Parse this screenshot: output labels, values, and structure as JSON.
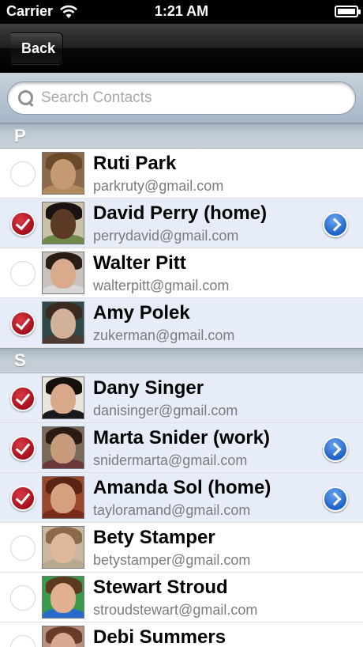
{
  "status_bar": {
    "carrier": "Carrier",
    "time": "1:21 AM"
  },
  "nav": {
    "back_label": "Back"
  },
  "search": {
    "placeholder": "Search Contacts",
    "value": ""
  },
  "sections": [
    {
      "letter": "P",
      "contacts": [
        {
          "name": "Ruti Park",
          "email": "parkruty@gmail.com",
          "selected": false,
          "has_detail": false,
          "skin": "#c59a72",
          "hair": "#6b4a2b",
          "shirt": "#b38a5e",
          "bg": "#8a6a4a"
        },
        {
          "name": "David Perry (home)",
          "email": "perrydavid@gmail.com",
          "selected": true,
          "has_detail": true,
          "skin": "#5a3a24",
          "hair": "#1a1210",
          "shirt": "#6f8a4a",
          "bg": "#c9c1a8"
        },
        {
          "name": "Walter Pitt",
          "email": "walterpitt@gmail.com",
          "selected": false,
          "has_detail": false,
          "skin": "#d9ab8c",
          "hair": "#2a1d14",
          "shirt": "#d8d8d8",
          "bg": "#c8c3be"
        },
        {
          "name": "Amy Polek",
          "email": "zukerman@gmail.com",
          "selected": true,
          "has_detail": false,
          "skin": "#d2b19a",
          "hair": "#3a2a20",
          "shirt": "#4a3a30",
          "bg": "#2f4a4a"
        }
      ]
    },
    {
      "letter": "S",
      "contacts": [
        {
          "name": "Dany Singer",
          "email": "danisinger@gmail.com",
          "selected": true,
          "has_detail": false,
          "skin": "#d8a88a",
          "hair": "#15100c",
          "shirt": "#1a1a1a",
          "bg": "#e8e4de"
        },
        {
          "name": "Marta Snider (work)",
          "email": "snidermarta@gmail.com",
          "selected": true,
          "has_detail": true,
          "skin": "#c89a7c",
          "hair": "#2a1a12",
          "shirt": "#6a3a3a",
          "bg": "#7a6a5a"
        },
        {
          "name": "Amanda Sol (home)",
          "email": "tayloramand@gmail.com",
          "selected": true,
          "has_detail": true,
          "skin": "#d5a080",
          "hair": "#5a2414",
          "shirt": "#7a2a1a",
          "bg": "#9a4a2a"
        },
        {
          "name": "Bety Stamper",
          "email": "betystamper@gmail.com",
          "selected": false,
          "has_detail": false,
          "skin": "#e0b89a",
          "hair": "#8a6a4a",
          "shirt": "#b8a890",
          "bg": "#c8b8a0"
        },
        {
          "name": "Stewart Stroud",
          "email": "stroudstewart@gmail.com",
          "selected": false,
          "has_detail": false,
          "skin": "#e2b090",
          "hair": "#5a3a20",
          "shirt": "#2a6acc",
          "bg": "#3a9a4a"
        },
        {
          "name": "Debi Summers",
          "email": "",
          "selected": false,
          "has_detail": false,
          "skin": "#d8a890",
          "hair": "#6a3a2a",
          "shirt": "#8a5a4a",
          "bg": "#b89080"
        }
      ]
    }
  ]
}
